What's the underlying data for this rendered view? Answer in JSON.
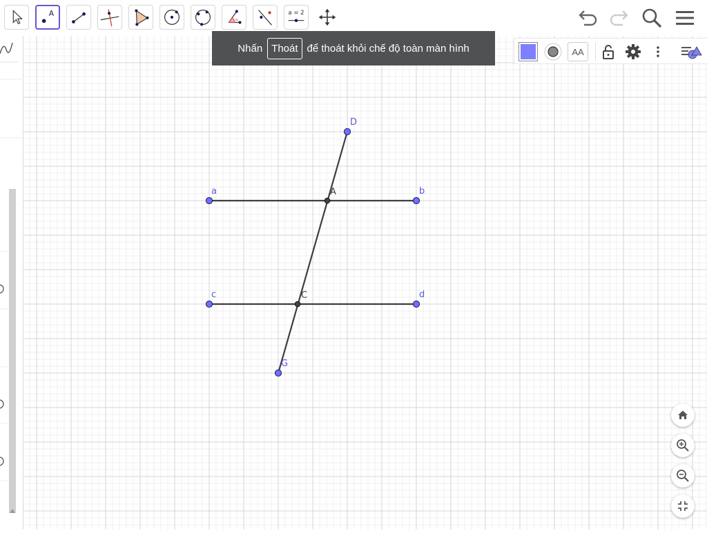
{
  "toolbar": {
    "tools": [
      {
        "name": "move-tool-button",
        "icon": "arrow-pointer-icon"
      },
      {
        "name": "point-tool-button",
        "icon": "point-icon",
        "label": "A"
      },
      {
        "name": "segment-tool-button",
        "icon": "segment-icon"
      },
      {
        "name": "perpendicular-line-tool-button",
        "icon": "perpendicular-line-icon"
      },
      {
        "name": "polygon-tool-button",
        "icon": "polygon-icon"
      },
      {
        "name": "circle-center-point-tool-button",
        "icon": "circle-center-icon"
      },
      {
        "name": "circle-three-points-tool-button",
        "icon": "circle-three-points-icon"
      },
      {
        "name": "angle-tool-button",
        "icon": "angle-icon"
      },
      {
        "name": "reflect-line-tool-button",
        "icon": "reflect-icon"
      },
      {
        "name": "slider-tool-button",
        "icon": "slider-icon",
        "label": "a = 2"
      },
      {
        "name": "move-graphics-view-tool-button",
        "icon": "move-arrows-icon"
      }
    ],
    "actions": [
      "undo-icon",
      "redo-icon",
      "search-icon",
      "menu-icon"
    ]
  },
  "banner": {
    "prefix": "Nhấn",
    "key": "Thoát",
    "suffix": "để thoát khỏi chế độ toàn màn hình"
  },
  "style_bar": {
    "color": "#7f7fff",
    "text_style_label": "AA"
  },
  "colors": {
    "point_fill": "#6f6fff",
    "point_stroke": "#1a1a5a",
    "intersection_fill": "#444444",
    "segment": "#3d3d3d",
    "label_blue": "#5b5bd6",
    "label_dark": "#444444",
    "grid_minor": "#efefef",
    "grid_major": "#d4d4d4",
    "accent": "#6557d2"
  },
  "graph": {
    "labels": {
      "a": "a",
      "b": "b",
      "c": "c",
      "d": "d",
      "A": "A",
      "C": "C",
      "D": "D",
      "G": "G"
    }
  },
  "zoom_controls": [
    "home-icon",
    "zoom-in-icon",
    "zoom-out-icon",
    "fullscreen-exit-icon"
  ]
}
